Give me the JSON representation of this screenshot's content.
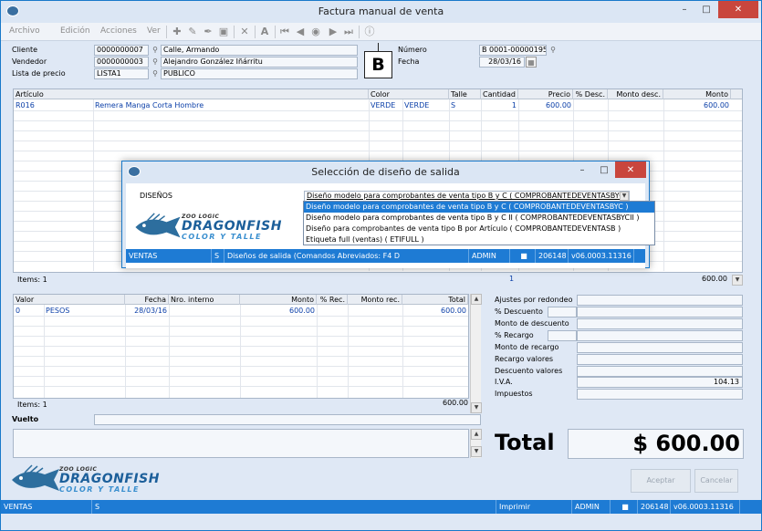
{
  "window": {
    "title": "Factura manual de venta"
  },
  "menu": [
    "Archivo",
    "Edición",
    "Acciones",
    "Ver"
  ],
  "header": {
    "cliente_label": "Cliente",
    "cliente_code": "0000000007",
    "cliente_name": "Calle, Armando",
    "vendedor_label": "Vendedor",
    "vendedor_code": "0000000003",
    "vendedor_name": "Alejandro González Iñárritu",
    "lista_label": "Lista de precio",
    "lista_code": "LISTA1",
    "lista_name": "PUBLICO",
    "letter": "B",
    "numero_label": "Número",
    "numero_value": "B 0001-00000195",
    "fecha_label": "Fecha",
    "fecha_value": "28/03/16"
  },
  "items_grid": {
    "columns": [
      "Artículo",
      "Color",
      "Talle",
      "Cantidad",
      "Precio",
      "% Desc.",
      "Monto desc.",
      "Monto"
    ],
    "row": {
      "articulo": "R016",
      "descripcion": "Remera Manga Corta Hombre",
      "color_code": "VERDE",
      "color_name": "VERDE",
      "talle": "S",
      "cantidad": "1",
      "precio": "600.00",
      "monto": "600.00"
    },
    "footer_label": "Items: 1",
    "footer_qty": "1",
    "footer_total": "600.00"
  },
  "values_grid": {
    "columns": [
      "Valor",
      "Fecha",
      "Nro. interno",
      "Monto",
      "% Rec.",
      "Monto rec.",
      "Total"
    ],
    "row": {
      "valor": "0",
      "nombre": "PESOS",
      "fecha": "28/03/16",
      "monto": "600.00",
      "total": "600.00"
    },
    "footer_label": "Items: 1",
    "footer_total": "600.00"
  },
  "vuelto_label": "Vuelto",
  "totals": {
    "ajustes_label": "Ajustes por redondeo",
    "pct_descuento_label": "% Descuento",
    "monto_descuento_label": "Monto de descuento",
    "pct_recargo_label": "% Recargo",
    "monto_recargo_label": "Monto de recargo",
    "recargo_valores_label": "Recargo valores",
    "descuento_valores_label": "Descuento valores",
    "iva_label": "I.V.A.",
    "iva_value": "104.13",
    "impuestos_label": "Impuestos",
    "total_label": "Total",
    "total_value": "$ 600.00"
  },
  "buttons": {
    "aceptar": "Aceptar",
    "cancelar": "Cancelar"
  },
  "logo": {
    "brand_small": "ZOO LOGIC",
    "brand": "DRAGONFISH",
    "tagline": "COLOR Y TALLE"
  },
  "status": {
    "module": "VENTAS",
    "flag": "S",
    "action": "Imprimir",
    "user": "ADMIN",
    "code": "206148",
    "version": "v06.0003.11316"
  },
  "dialog": {
    "title": "Selección de diseño de salida",
    "label": "DISEÑOS",
    "selected": "Diseño modelo para comprobantes de venta tipo B y C ( COMPROBANTEDEVENTASBYC )",
    "options": [
      "Diseño modelo para comprobantes de venta tipo B y C ( COMPROBANTEDEVENTASBYC )",
      "Diseño modelo para comprobantes de venta tipo B y C II ( COMPROBANTEDEVENTASBYCII )",
      "Diseño para comprobantes de venta tipo B por Artículo ( COMPROBANTEDEVENTASB )",
      "Etiqueta full (ventas) ( ETIFULL )"
    ],
    "status": {
      "module": "VENTAS",
      "flag": "S",
      "info": "Diseños de salida (Comandos Abreviados: F4 D",
      "user": "ADMIN",
      "code": "206148",
      "version": "v06.0003.11316"
    }
  },
  "colors": {
    "accent": "#1e7bd4",
    "frame": "#dfe8f5",
    "link_text": "#0b3fa8"
  }
}
